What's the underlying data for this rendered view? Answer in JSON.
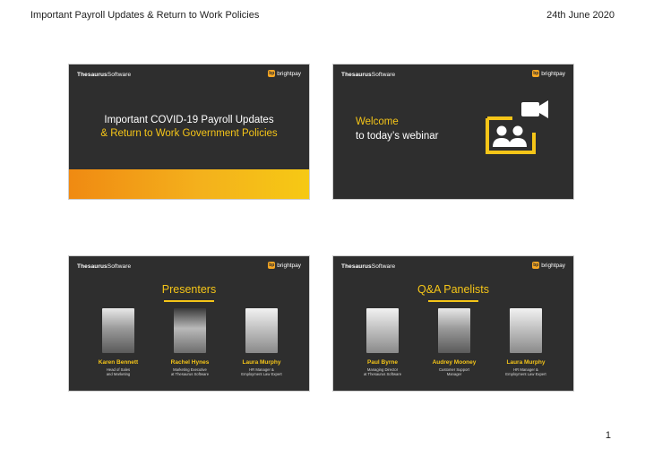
{
  "header": {
    "title": "Important Payroll Updates & Return to Work Policies",
    "date": "24th June 2020"
  },
  "page_number": "1",
  "brand": {
    "thesaurus_bold": "Thesaurus",
    "thesaurus_light": "Software",
    "brightpay_mark": "bp",
    "brightpay": "brightpay"
  },
  "slides": {
    "s1": {
      "line1": "Important COVID-19 Payroll Updates",
      "line2": "& Return to Work Government Policies"
    },
    "s2": {
      "welcome": "Welcome",
      "sub": "to today’s webinar"
    },
    "s3": {
      "title": "Presenters",
      "people": [
        {
          "name": "Karen Bennett",
          "role1": "Head of Sales",
          "role2": "and Marketing"
        },
        {
          "name": "Rachel Hynes",
          "role1": "Marketing Executive",
          "role2": "at Thesaurus Software"
        },
        {
          "name": "Laura Murphy",
          "role1": "HR Manager &",
          "role2": "Employment Law Expert"
        }
      ]
    },
    "s4": {
      "title": "Q&A Panelists",
      "people": [
        {
          "name": "Paul Byrne",
          "role1": "Managing Director",
          "role2": "at Thesaurus Software"
        },
        {
          "name": "Audrey Mooney",
          "role1": "Customer Support",
          "role2": "Manager"
        },
        {
          "name": "Laura Murphy",
          "role1": "HR Manager &",
          "role2": "Employment Law Expert"
        }
      ]
    }
  },
  "colors": {
    "slide_bg": "#2e2e2e",
    "accent_yellow": "#f5c518",
    "accent_orange": "#f08a12"
  }
}
